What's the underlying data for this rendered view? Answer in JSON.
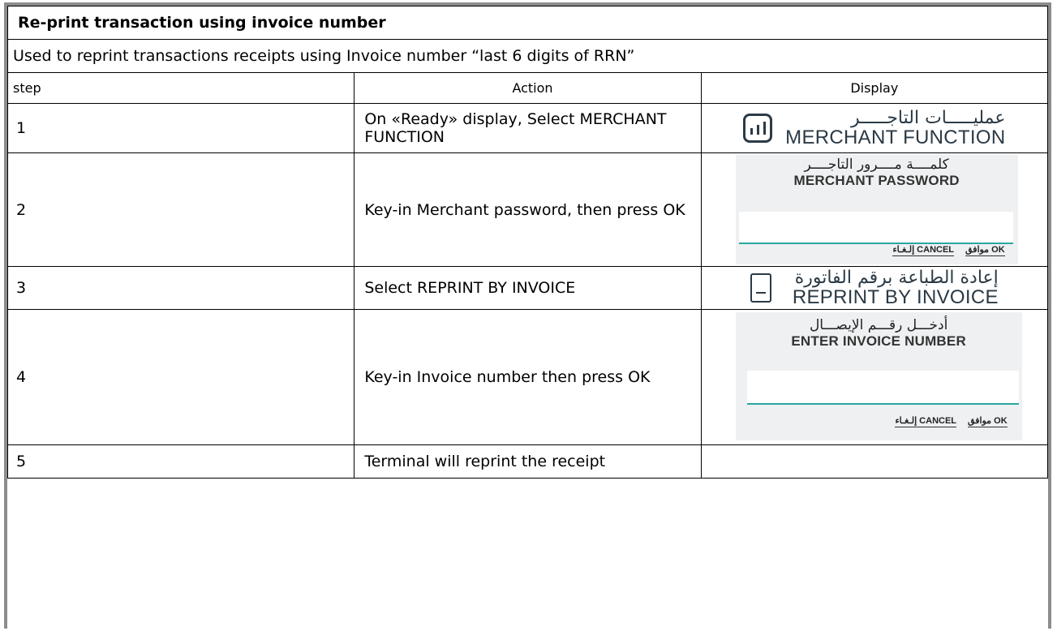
{
  "title": "Re-print transaction using invoice number",
  "description": "Used to reprint transactions receipts using Invoice number “last 6 digits of RRN”",
  "columns": {
    "step": "step",
    "action": "Action",
    "display": "Display"
  },
  "rows": [
    {
      "step": "1",
      "action": "On «Ready» display, Select MERCHANT FUNCTION"
    },
    {
      "step": "2",
      "action": "Key-in Merchant password, then press OK"
    },
    {
      "step": "3",
      "action": "Select REPRINT BY INVOICE"
    },
    {
      "step": "4",
      "action": "Key-in Invoice number then press OK"
    },
    {
      "step": "5",
      "action": "Terminal will reprint the receipt"
    }
  ],
  "displays": {
    "merchant_function": {
      "ar": "عمليـــــات التاجـــــر",
      "en": "MERCHANT FUNCTION",
      "icon": "bar-chart-icon"
    },
    "merchant_password": {
      "ar": "كلمــــة مــــرور التاجــــر",
      "en": "MERCHANT PASSWORD",
      "ok": "موافق OK",
      "cancel": "إلـغـاء CANCEL"
    },
    "reprint_by_invoice": {
      "ar": "إعادة الطباعة برقم الفاتورة",
      "en": "REPRINT BY INVOICE",
      "icon": "receipt-icon"
    },
    "enter_invoice": {
      "ar": "أدخـــل رقـــم الإيصـــال",
      "en": "ENTER INVOICE NUMBER",
      "ok": "موافق OK",
      "cancel": "إلـغـاء CANCEL"
    }
  },
  "colors": {
    "accent": "#2aa7a0",
    "icon": "#2b3a45",
    "panel": "#eef0f2"
  }
}
